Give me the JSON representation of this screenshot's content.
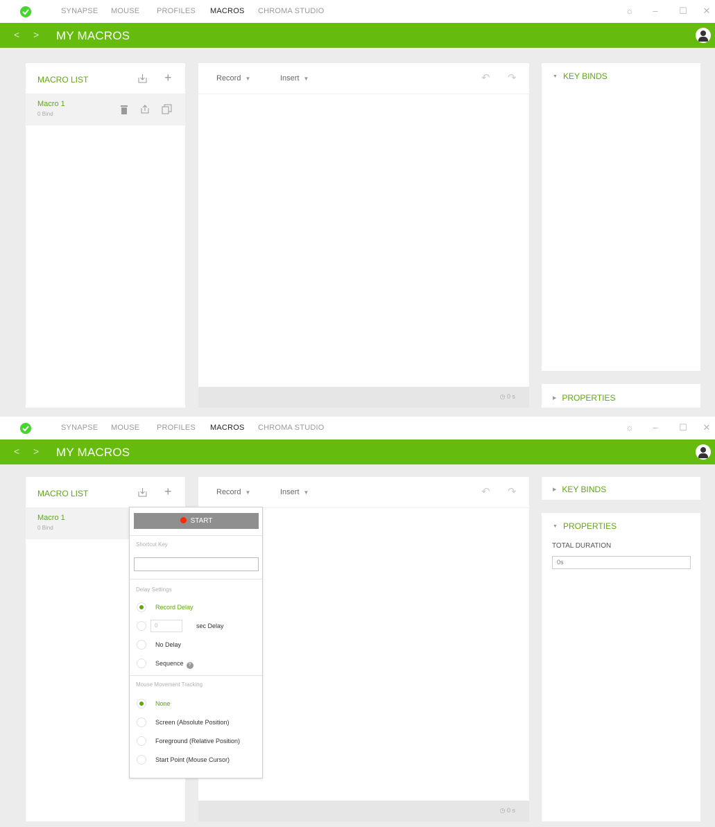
{
  "nav": {
    "tabs": [
      "SYNAPSE",
      "MOUSE",
      "PROFILES",
      "MACROS",
      "CHROMA STUDIO"
    ],
    "active_tab": "MACROS"
  },
  "header": {
    "back": "<",
    "forward": ">",
    "title": "MY MACROS"
  },
  "macro_list": {
    "title": "MACRO LIST",
    "items": [
      {
        "name": "Macro 1",
        "binds": "0 Bind"
      }
    ]
  },
  "editor": {
    "record_label": "Record",
    "insert_label": "Insert",
    "duration": "0 s"
  },
  "right_panel": {
    "key_binds": "KEY BINDS",
    "properties": "PROPERTIES",
    "total_duration_label": "TOTAL DURATION",
    "total_duration_value": "0s"
  },
  "record_menu": {
    "start": "START",
    "shortcut_key_label": "Shortcut Key",
    "delay_settings_label": "Delay Settings",
    "delay_options": {
      "record_delay": "Record Delay",
      "sec_delay_value": "0",
      "sec_delay": "sec Delay",
      "no_delay": "No Delay",
      "sequence": "Sequence"
    },
    "mouse_tracking_label": "Mouse Movement Tracking",
    "mouse_options": {
      "none": "None",
      "screen": "Screen (Absolute Position)",
      "foreground": "Foreground (Relative Position)",
      "start_point": "Start Point (Mouse Cursor)"
    }
  },
  "colors": {
    "accent": "#66bb0f",
    "accent_text": "#5ea90f",
    "record_dot": "#ff2a00"
  }
}
